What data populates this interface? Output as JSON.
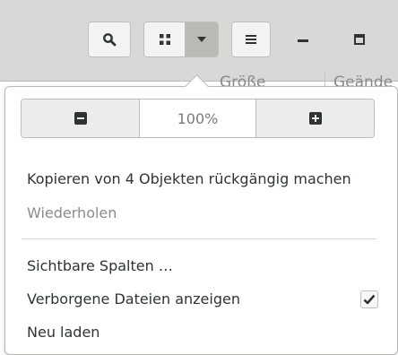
{
  "header": {
    "search_icon": "search-icon",
    "grid_icon": "grid-view-icon",
    "dropdown_icon": "chevron-down-icon",
    "menu_icon": "hamburger-menu-icon",
    "minimize_icon": "minimize-icon",
    "maximize_icon": "maximize-icon"
  },
  "columns": {
    "size": "Größe",
    "changed": "Geände"
  },
  "popover": {
    "zoom": {
      "out_icon": "zoom-out-icon",
      "in_icon": "zoom-in-icon",
      "value": "100%"
    },
    "undo_label": "Kopieren von 4 Objekten rückgängig machen",
    "redo_label": "Wiederholen",
    "visible_columns_label": "Sichtbare Spalten …",
    "show_hidden_label": "Verborgene Dateien anzeigen",
    "show_hidden_checked": true,
    "reload_label": "Neu laden"
  },
  "colors": {
    "headerbar": "#d8d8d6",
    "text": "#2e3436",
    "dim_text": "#8c8c8a"
  }
}
